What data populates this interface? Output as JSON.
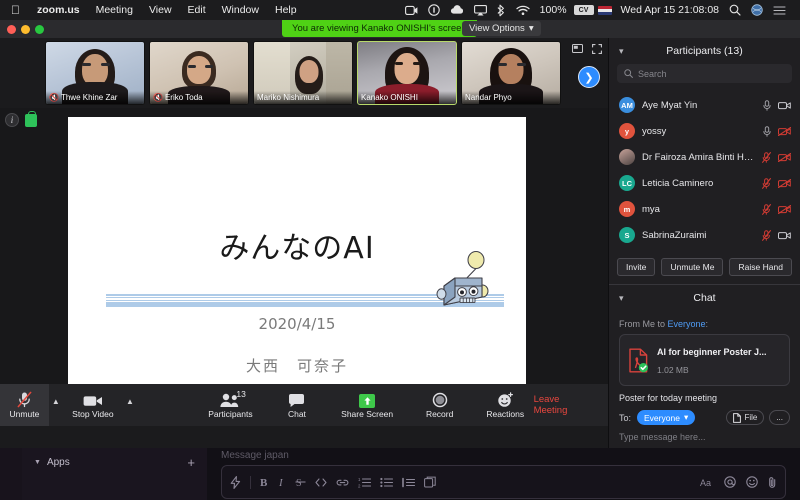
{
  "menubar": {
    "apple": "apple-logo",
    "items": [
      {
        "label": "zoom.us",
        "bold": true
      },
      {
        "label": "Meeting",
        "bold": false
      },
      {
        "label": "View",
        "bold": false
      },
      {
        "label": "Edit",
        "bold": false
      },
      {
        "label": "Window",
        "bold": false
      },
      {
        "label": "Help",
        "bold": false
      }
    ],
    "battery_percent": "100%",
    "battery_badge": "CV",
    "datetime": "Wed Apr 15  21:08:08"
  },
  "zoom_window": {
    "share_banner": "You are viewing Kanako ONISHI's screen",
    "view_options": "View Options",
    "filmstrip": [
      {
        "name": "Thwe Khine Zar",
        "muted": true,
        "active": false
      },
      {
        "name": "Eriko Toda",
        "muted": true,
        "active": false
      },
      {
        "name": "Mariko Nishimura",
        "muted": false,
        "active": false
      },
      {
        "name": "Kanako ONISHI",
        "muted": false,
        "active": true
      },
      {
        "name": "Nandar Phyo",
        "muted": false,
        "active": false
      }
    ],
    "next_button": "next-participants",
    "slide": {
      "title": "みんなのAI",
      "date": "2020/4/15",
      "author": "大西　可奈子"
    },
    "toolbar": {
      "mute_label": "Unmute",
      "video_label": "Stop Video",
      "participants_label": "Participants",
      "participants_count": "13",
      "chat_label": "Chat",
      "share_label": "Share Screen",
      "record_label": "Record",
      "reactions_label": "Reactions",
      "leave_label": "Leave Meeting"
    }
  },
  "participants_panel": {
    "title": "Participants (13)",
    "search_placeholder": "Search",
    "rows": [
      {
        "initials": "AM",
        "name": "Aye Myat Yin",
        "color": "#3a8ede",
        "mic_off": false,
        "cam_off": false,
        "photo": false
      },
      {
        "initials": "y",
        "name": "yossy",
        "color": "#e0533d",
        "mic_off": false,
        "cam_off": true,
        "photo": false
      },
      {
        "initials": "",
        "name": "Dr Fairoza Amira Binti Hamzah",
        "color": "#9b8f86",
        "mic_off": true,
        "cam_off": true,
        "photo": true
      },
      {
        "initials": "LC",
        "name": "Leticia Caminero",
        "color": "#19a88f",
        "mic_off": true,
        "cam_off": true,
        "photo": false
      },
      {
        "initials": "m",
        "name": "mya",
        "color": "#e0533d",
        "mic_off": true,
        "cam_off": true,
        "photo": false
      },
      {
        "initials": "S",
        "name": "SabrinaZuraimi",
        "color": "#19a88f",
        "mic_off": true,
        "cam_off": false,
        "photo": false
      }
    ],
    "buttons": {
      "invite": "Invite",
      "unmute_me": "Unmute Me",
      "raise_hand": "Raise Hand"
    }
  },
  "chat_panel": {
    "title": "Chat",
    "from_prefix": "From Me to ",
    "from_target": "Everyone",
    "from_suffix": ":",
    "file": {
      "name": "AI for beginner Poster J...",
      "size": "1.02 MB"
    },
    "message": "Poster for today meeting",
    "to_label": "To:",
    "to_value": "Everyone",
    "file_button": "File",
    "more_button": "...",
    "input_placeholder": "Type message here..."
  },
  "slack": {
    "sidebar_section": "Apps",
    "add_label": "+",
    "message_placeholder": "Message japan"
  },
  "colors": {
    "zoom_blue": "#2d8cff",
    "share_green": "#4fd215",
    "leave_red": "#e8473f",
    "mute_red": "#e2483c"
  }
}
